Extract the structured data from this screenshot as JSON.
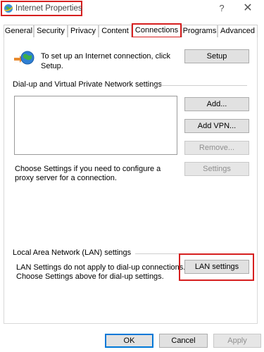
{
  "window": {
    "title": "Internet Properties",
    "help_glyph": "?",
    "close_glyph": "✕"
  },
  "tabs": [
    {
      "label": "General"
    },
    {
      "label": "Security"
    },
    {
      "label": "Privacy"
    },
    {
      "label": "Content"
    },
    {
      "label": "Connections"
    },
    {
      "label": "Programs"
    },
    {
      "label": "Advanced"
    }
  ],
  "setup": {
    "text": "To set up an Internet connection, click Setup.",
    "button": "Setup"
  },
  "dialup": {
    "group_label": "Dial-up and Virtual Private Network settings",
    "add_button": "Add...",
    "add_vpn_button": "Add VPN...",
    "remove_button": "Remove...",
    "settings_button": "Settings",
    "proxy_text": "Choose Settings if you need to configure a proxy server for a connection."
  },
  "lan": {
    "group_label": "Local Area Network (LAN) settings",
    "text_line1": "LAN Settings do not apply to dial-up connections.",
    "text_line2": "Choose Settings above for dial-up settings.",
    "button": "LAN settings"
  },
  "footer": {
    "ok": "OK",
    "cancel": "Cancel",
    "apply": "Apply"
  },
  "colors": {
    "highlight": "#d61f1f",
    "button_face": "#e1e1e1",
    "focus_blue": "#0078d7"
  }
}
